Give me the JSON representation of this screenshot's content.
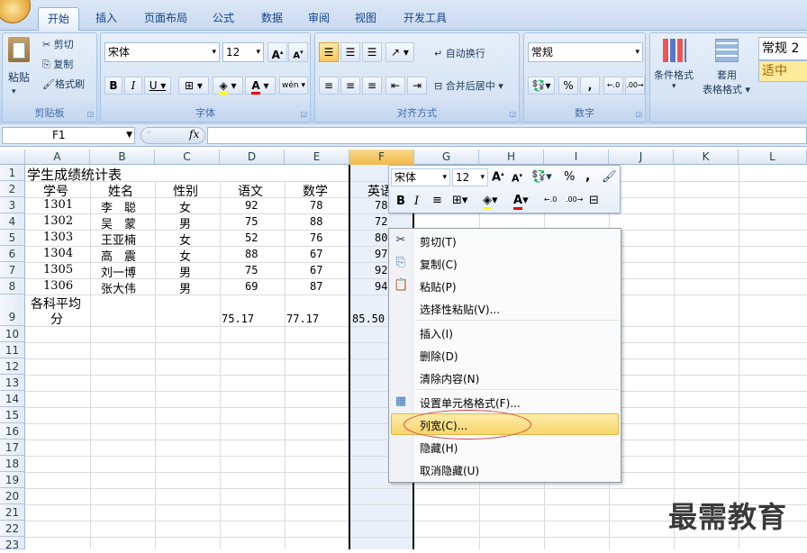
{
  "tabs": [
    "开始",
    "插入",
    "页面布局",
    "公式",
    "数据",
    "审阅",
    "视图",
    "开发工具"
  ],
  "clipboard": {
    "paste": "粘贴",
    "cut": "剪切",
    "copy": "复制",
    "format_painter": "格式刷",
    "label": "剪贴板"
  },
  "font": {
    "name": "宋体",
    "size": "12",
    "label": "字体",
    "wen": "wén"
  },
  "alignment": {
    "wrap": "自动换行",
    "merge": "合并后居中",
    "label": "对齐方式"
  },
  "number": {
    "format": "常规",
    "label": "数字"
  },
  "styles": {
    "conditional": "条件格式",
    "table_fmt_1": "套用",
    "table_fmt_2": "表格格式",
    "style_normal": "常规 2",
    "style_medium": "适中"
  },
  "formula_bar": {
    "cell_ref": "F1",
    "fx": "fx"
  },
  "columns": [
    "A",
    "B",
    "C",
    "D",
    "E",
    "F",
    "G",
    "H",
    "I",
    "J",
    "K",
    "L"
  ],
  "rows": [
    "1",
    "2",
    "3",
    "4",
    "5",
    "6",
    "7",
    "8",
    "9",
    "10",
    "11",
    "12",
    "13",
    "14",
    "15",
    "16",
    "17",
    "18",
    "19",
    "20",
    "21",
    "22",
    "23"
  ],
  "sheet": {
    "title": "学生成绩统计表",
    "headers": [
      "学号",
      "姓名",
      "性别",
      "语文",
      "数学",
      "英语"
    ],
    "records": [
      [
        "1301",
        "李　聪",
        "女",
        "92",
        "78",
        "78"
      ],
      [
        "1302",
        "吴　蒙",
        "男",
        "75",
        "88",
        "72"
      ],
      [
        "1303",
        "王亚楠",
        "女",
        "52",
        "76",
        "80"
      ],
      [
        "1304",
        "高　震",
        "女",
        "88",
        "67",
        "97"
      ],
      [
        "1305",
        "刘一博",
        "男",
        "75",
        "67",
        "92"
      ],
      [
        "1306",
        "张大伟",
        "男",
        "69",
        "87",
        "94"
      ]
    ],
    "avg_label_1": "各科平均",
    "avg_label_2": "分",
    "avg": [
      "75.17",
      "77.17",
      "85.50"
    ]
  },
  "mini_toolbar": {
    "font": "宋体",
    "size": "12",
    "percent": "%",
    "comma": ","
  },
  "context_menu": {
    "cut": "剪切(T)",
    "copy": "复制(C)",
    "paste": "粘贴(P)",
    "paste_special": "选择性粘贴(V)...",
    "insert": "插入(I)",
    "delete": "删除(D)",
    "clear": "清除内容(N)",
    "format_cells": "设置单元格格式(F)...",
    "col_width": "列宽(C)...",
    "hide": "隐藏(H)",
    "unhide": "取消隐藏(U)"
  },
  "watermark": "最需教育",
  "colors": {
    "highlight": "#f9d66c",
    "annotation": "#d64242"
  }
}
